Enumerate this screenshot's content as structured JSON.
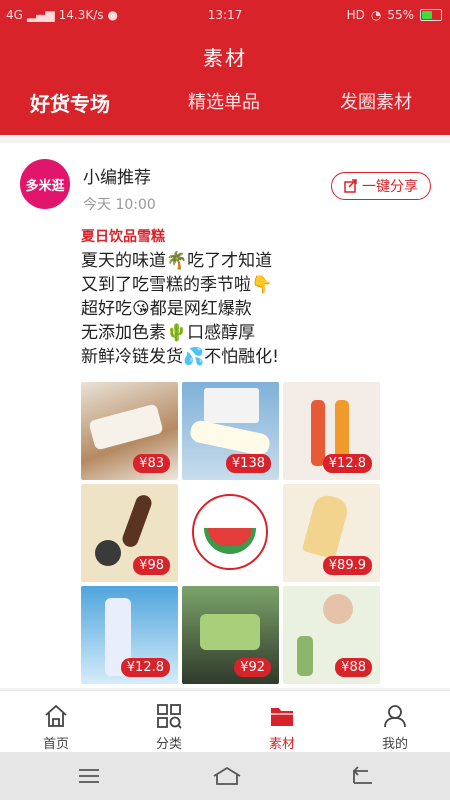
{
  "status_bar": {
    "network": "4G",
    "speed": "14.3K/s",
    "time": "13:17",
    "hd": "HD",
    "battery": "55%",
    "battery_level": 0.55
  },
  "header": {
    "title": "素材",
    "tabs": [
      {
        "label": "好货专场",
        "active": true
      },
      {
        "label": "精选单品",
        "active": false
      },
      {
        "label": "发圈素材",
        "active": false
      }
    ]
  },
  "post": {
    "logo_text": "多米逛",
    "author": "小编推荐",
    "time": "今天 10:00",
    "share_label": "一键分享",
    "title": "夏日饮品雪糕",
    "lines": [
      "夏天的味道🌴吃了才知道",
      "又到了吃雪糕的季节啦👇",
      "超好吃😘都是网红爆款",
      "无添加色素🌵口感醇厚",
      "新鲜冷链发货💦不怕融化!"
    ],
    "products": [
      {
        "price": "¥83"
      },
      {
        "price": "¥138"
      },
      {
        "price": "¥12.8"
      },
      {
        "price": "¥98"
      },
      {
        "price": ""
      },
      {
        "price": "¥89.9"
      },
      {
        "price": "¥12.8"
      },
      {
        "price": "¥92"
      },
      {
        "price": "¥88"
      }
    ]
  },
  "bottom_nav": {
    "items": [
      {
        "label": "首页",
        "icon": "home-icon"
      },
      {
        "label": "分类",
        "icon": "category-icon"
      },
      {
        "label": "素材",
        "icon": "folder-icon",
        "active": true
      },
      {
        "label": "我的",
        "icon": "user-icon"
      }
    ]
  },
  "colors": {
    "brand_red": "#d9232b",
    "logo_pink": "#e0156b"
  }
}
